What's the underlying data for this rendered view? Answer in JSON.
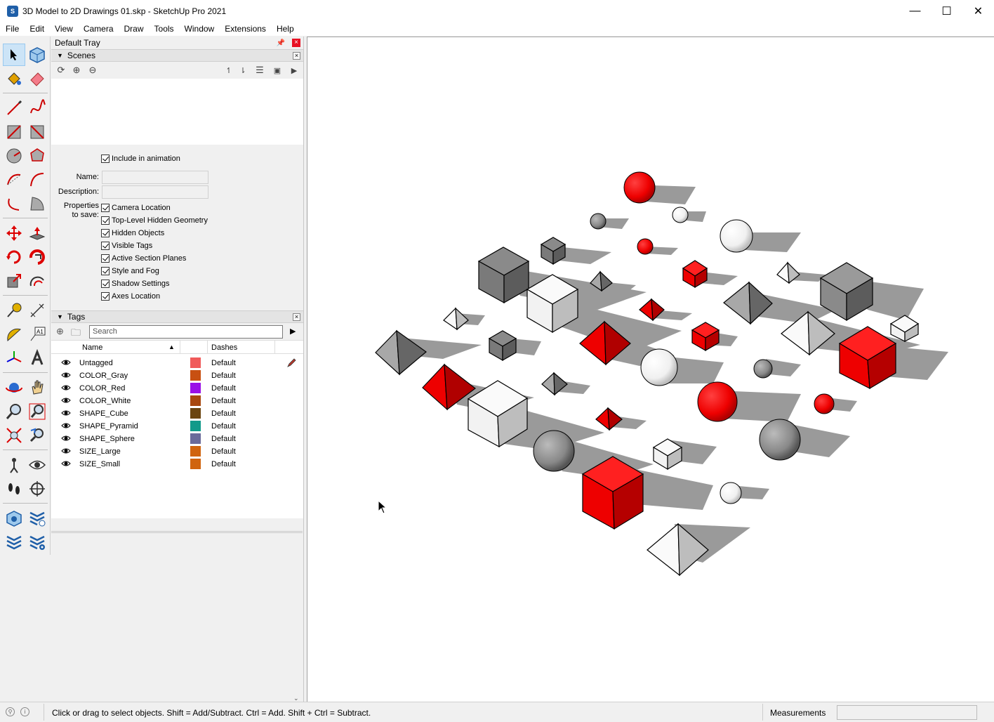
{
  "window": {
    "title": "3D Model to 2D Drawings 01.skp - SketchUp Pro 2021",
    "controls": {
      "minimize": "—",
      "maximize": "☐",
      "close": "✕"
    }
  },
  "menu": [
    "File",
    "Edit",
    "View",
    "Camera",
    "Draw",
    "Tools",
    "Window",
    "Extensions",
    "Help"
  ],
  "tray": {
    "title": "Default Tray",
    "scenes": {
      "title": "Scenes",
      "include_in_animation": "Include in animation",
      "name_label": "Name:",
      "description_label": "Description:",
      "properties_label_1": "Properties",
      "properties_label_2": "to save:",
      "properties": [
        "Camera Location",
        "Top-Level Hidden Geometry",
        "Hidden Objects",
        "Visible Tags",
        "Active Section Planes",
        "Style and Fog",
        "Shadow Settings",
        "Axes Location"
      ]
    },
    "tags": {
      "title": "Tags",
      "search_placeholder": "Search",
      "col_name": "Name",
      "col_dashes": "Dashes",
      "rows": [
        {
          "name": "Untagged",
          "color": "#f05a5a",
          "dashes": "Default"
        },
        {
          "name": "COLOR_Gray",
          "color": "#c85012",
          "dashes": "Default"
        },
        {
          "name": "COLOR_Red",
          "color": "#9a10e6",
          "dashes": "Default"
        },
        {
          "name": "COLOR_White",
          "color": "#a8480f",
          "dashes": "Default"
        },
        {
          "name": "SHAPE_Cube",
          "color": "#6b4510",
          "dashes": "Default"
        },
        {
          "name": "SHAPE_Pyramid",
          "color": "#129a8a",
          "dashes": "Default"
        },
        {
          "name": "SHAPE_Sphere",
          "color": "#6a6a9a",
          "dashes": "Default"
        },
        {
          "name": "SIZE_Large",
          "color": "#d0640f",
          "dashes": "Default"
        },
        {
          "name": "SIZE_Small",
          "color": "#d0640f",
          "dashes": "Default"
        }
      ]
    }
  },
  "status": {
    "message": "Click or drag to select objects. Shift = Add/Subtract. Ctrl = Add. Shift + Ctrl = Subtract.",
    "measurements_label": "Measurements"
  }
}
